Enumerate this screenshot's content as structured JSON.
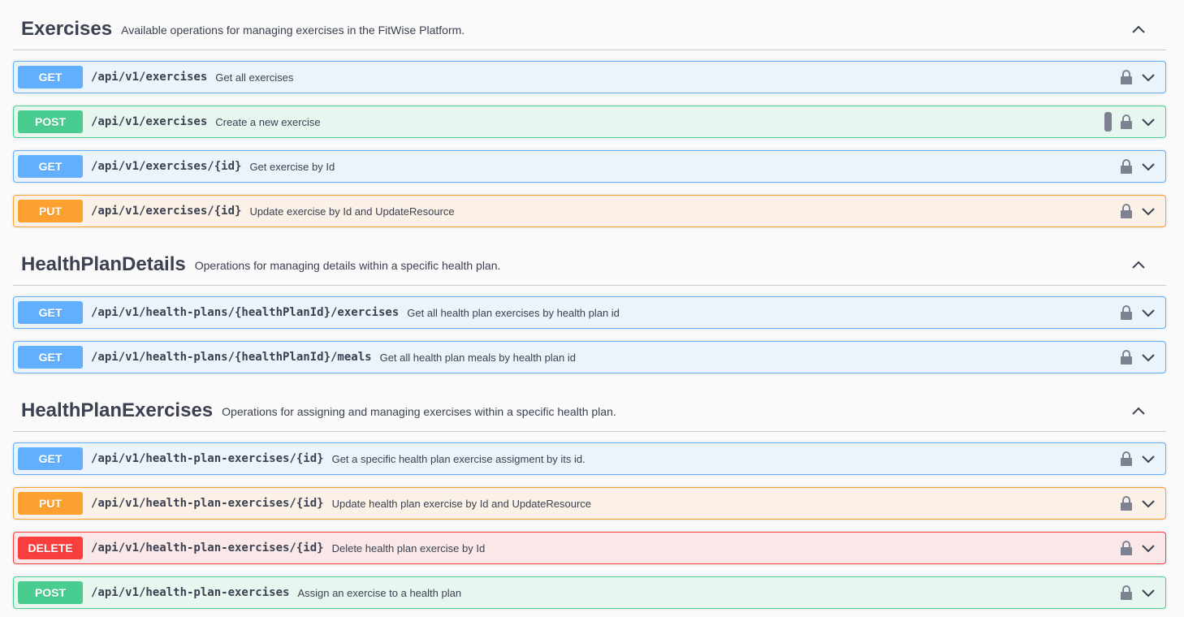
{
  "sections": [
    {
      "name": "Exercises",
      "description": "Available operations for managing exercises in the FitWise Platform.",
      "operations": [
        {
          "method": "GET",
          "path": "/api/v1/exercises",
          "summary": "Get all exercises"
        },
        {
          "method": "POST",
          "path": "/api/v1/exercises",
          "summary": "Create a new exercise"
        },
        {
          "method": "GET",
          "path": "/api/v1/exercises/{id}",
          "summary": "Get exercise by Id"
        },
        {
          "method": "PUT",
          "path": "/api/v1/exercises/{id}",
          "summary": "Update exercise by Id and UpdateResource"
        }
      ]
    },
    {
      "name": "HealthPlanDetails",
      "description": "Operations for managing details within a specific health plan.",
      "operations": [
        {
          "method": "GET",
          "path": "/api/v1/health-plans/{healthPlanId}/exercises",
          "summary": "Get all health plan exercises by health plan id"
        },
        {
          "method": "GET",
          "path": "/api/v1/health-plans/{healthPlanId}/meals",
          "summary": "Get all health plan meals by health plan id"
        }
      ]
    },
    {
      "name": "HealthPlanExercises",
      "description": "Operations for assigning and managing exercises within a specific health plan.",
      "operations": [
        {
          "method": "GET",
          "path": "/api/v1/health-plan-exercises/{id}",
          "summary": "Get a specific health plan exercise assigment by its id."
        },
        {
          "method": "PUT",
          "path": "/api/v1/health-plan-exercises/{id}",
          "summary": "Update health plan exercise by Id and UpdateResource"
        },
        {
          "method": "DELETE",
          "path": "/api/v1/health-plan-exercises/{id}",
          "summary": "Delete health plan exercise by Id"
        },
        {
          "method": "POST",
          "path": "/api/v1/health-plan-exercises",
          "summary": "Assign an exercise to a health plan"
        }
      ]
    }
  ],
  "colors": {
    "get": "#61affe",
    "post": "#49cc90",
    "put": "#fca130",
    "delete": "#f93e3e"
  },
  "icons": {
    "section_toggle": "chevron-up-icon",
    "operation_toggle": "chevron-down-icon",
    "authorization": "lock-icon"
  }
}
